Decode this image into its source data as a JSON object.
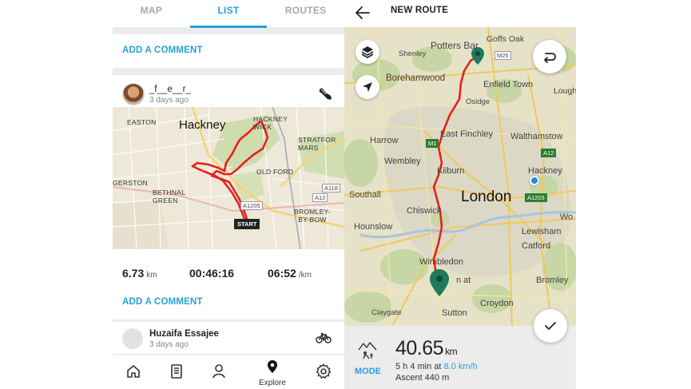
{
  "left_phone": {
    "tabs": [
      {
        "label": "MAP"
      },
      {
        "label": "LIST"
      },
      {
        "label": "ROUTES"
      }
    ],
    "add_comment_label": "ADD A COMMENT",
    "post": {
      "user": "_f__e__r_",
      "time": "3 days ago",
      "activity_icon": "running-shoe-icon",
      "map_labels": {
        "hackney": "Hackney",
        "hackney_wick": "HACKNEY WICK",
        "easton": "EASTON",
        "stratford_marsh": "STRATFOR MARS",
        "old_ford": "OLD FORD",
        "haggerston": "GERSTON",
        "bethnal_green": "BETHNAL GREEN",
        "bromley_by_bow": "BROMLEY-BY-BOW",
        "a118": "A118",
        "a12": "A12",
        "a1205": "A1205",
        "start": "START"
      },
      "distance": "6.73",
      "distance_unit": "km",
      "duration": "00:46:16",
      "pace": "06:52",
      "pace_unit": "/km"
    },
    "second_post": {
      "user": "Huzaifa Essajee",
      "time": "3 days ago",
      "activity_icon": "bicycle-icon"
    },
    "nav": {
      "explore_label": "Explore"
    }
  },
  "right_phone": {
    "title": "NEW ROUTE",
    "map_labels": {
      "potters_bar": "Potters Bar",
      "goffs_oak": "Goffs Oak",
      "shenley": "Shenley",
      "m25": "M25",
      "borehamwood": "Borehamwood",
      "enfield_town": "Enfield Town",
      "lough": "Lough",
      "osidge": "Osidge",
      "east_finchley": "East Finchley",
      "harrow": "Harrow",
      "walthamstow": "Walthamstow",
      "m1": "M1",
      "a12": "A12",
      "wembley": "Wembley",
      "kilburn": "Kilburn",
      "hackney": "Hackney",
      "london": "London",
      "southall": "Southall",
      "a1203": "A1203",
      "chiswick": "Chiswick",
      "wo": "Wo",
      "hounslow": "Hounslow",
      "lewisham": "Lewisham",
      "catford": "Catford",
      "wimbledon": "Wimbledon",
      "bromley": "Bromley",
      "mitcham": "n at",
      "claygate": "Claygate",
      "sutton": "Sutton",
      "croydon": "Croydon"
    },
    "mode_label": "MODE",
    "distance": "40.65",
    "distance_unit": "km",
    "duration_prefix": "5 h 4 min at ",
    "speed": "8.0 km/h",
    "ascent": "Ascent 440 m"
  },
  "colors": {
    "accent": "#26a1db",
    "route": "#e8201c",
    "marker": "#1f7a5c"
  }
}
